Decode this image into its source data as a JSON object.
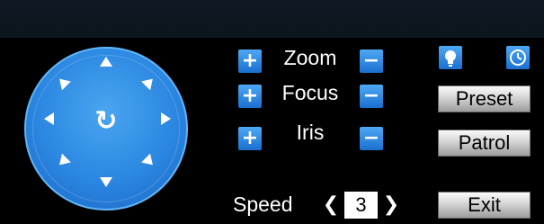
{
  "ptz": {
    "center_symbol": "↻",
    "zoom_label": "Zoom",
    "focus_label": "Focus",
    "iris_label": "Iris",
    "plus": "+",
    "minus": "−"
  },
  "buttons": {
    "preset": "Preset",
    "patrol": "Patrol",
    "exit": "Exit"
  },
  "speed": {
    "label": "Speed",
    "value": "3",
    "prev": "❮",
    "next": "❯"
  },
  "colors": {
    "wheel": "#2a86e0",
    "button_blue": "#1a6fd0",
    "panel": "#000000",
    "topbar": "#101923"
  },
  "icons": {
    "light": "light-bulb-icon",
    "wiper": "clock-icon"
  }
}
